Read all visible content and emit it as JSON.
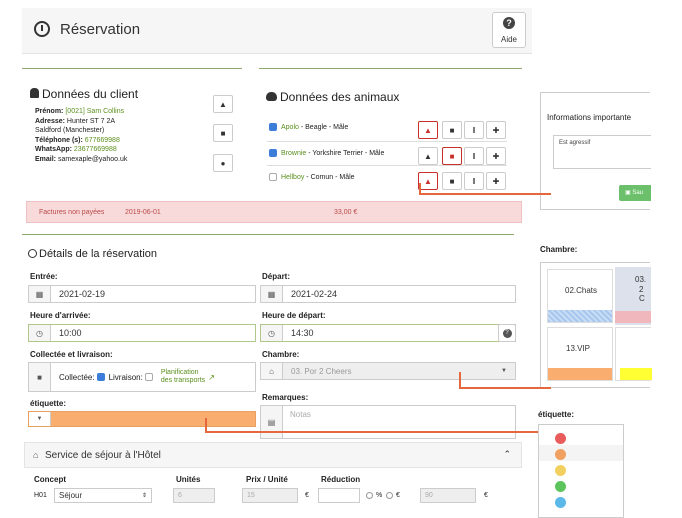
{
  "header": {
    "title": "Réservation",
    "help_label": "Aide"
  },
  "client": {
    "title": "Données du client",
    "prenom_label": "Prénom:",
    "prenom_value": "[0021] Sam Collins",
    "adresse_label": "Adresse:",
    "adresse_value": "Hunter ST 7 2A",
    "city": "Saldford (Manchester)",
    "tel_label": "Téléphone (s):",
    "tel_value": "677669988",
    "wa_label": "WhatsApp:",
    "wa_value": "23677669988",
    "email_label": "Email:",
    "email_value": "samexaple@yahoo.uk"
  },
  "animals": {
    "title": "Données des animaux",
    "items": [
      {
        "name": "Apolo",
        "desc": " - Beagle - Mâle",
        "checked": true
      },
      {
        "name": "Brownie",
        "desc": " - Yorkshire Terrier - Mâle",
        "checked": true
      },
      {
        "name": "Hellboy",
        "desc": " - Comun - Mâle",
        "checked": false
      }
    ]
  },
  "invoice": {
    "label": "Factures non payées",
    "date": "2019-06-01",
    "amount": "33,00 €"
  },
  "details": {
    "title": "Détails de la réservation",
    "entree_label": "Entrée:",
    "entree_value": "2021-02-19",
    "depart_label": "Départ:",
    "depart_value": "2021-02-24",
    "arrivee_label": "Heure d'arrivée:",
    "arrivee_value": "10:00",
    "heure_depart_label": "Heure de départ:",
    "heure_depart_value": "14:30",
    "collecte_label": "Collectée et livraison:",
    "collectee": "Collectée:",
    "livraison": "Livraison:",
    "planif_line1": "Planification",
    "planif_line2": "des transports",
    "chambre_label": "Chambre:",
    "chambre_value": "03. Por 2 Cheers",
    "etiquette_label": "étiquette:",
    "remarques_label": "Remarques:",
    "notes_placeholder": "Notas"
  },
  "service": {
    "title": "Service de séjour à l'Hôtel",
    "col_concept": "Concept",
    "col_units": "Unités",
    "col_price": "Prix / Unité",
    "col_reduction": "Réduction",
    "row_code": "H01",
    "row_concept": "Séjour",
    "row_units": "6",
    "row_price": "15",
    "row_total": "90",
    "currency": "€",
    "pct": "%"
  },
  "side": {
    "info_title": "Informations importante",
    "info_text": "Est agressif",
    "save_label": "Sau",
    "chambre_label": "Chambre:",
    "rooms": [
      {
        "name": "02.Chats"
      },
      {
        "name": "03.",
        "sub": "2 C"
      },
      {
        "name": "13.VIP"
      }
    ],
    "etiquette_label": "étiquette:",
    "tag_colors": [
      "#e85c5c",
      "#f0a060",
      "#f2d060",
      "#5cc45c",
      "#5cb8e8"
    ]
  },
  "colors": {
    "accent_orange": "#f9ae70",
    "connector": "#e4683c",
    "invoice_bg": "#f8dadb"
  }
}
